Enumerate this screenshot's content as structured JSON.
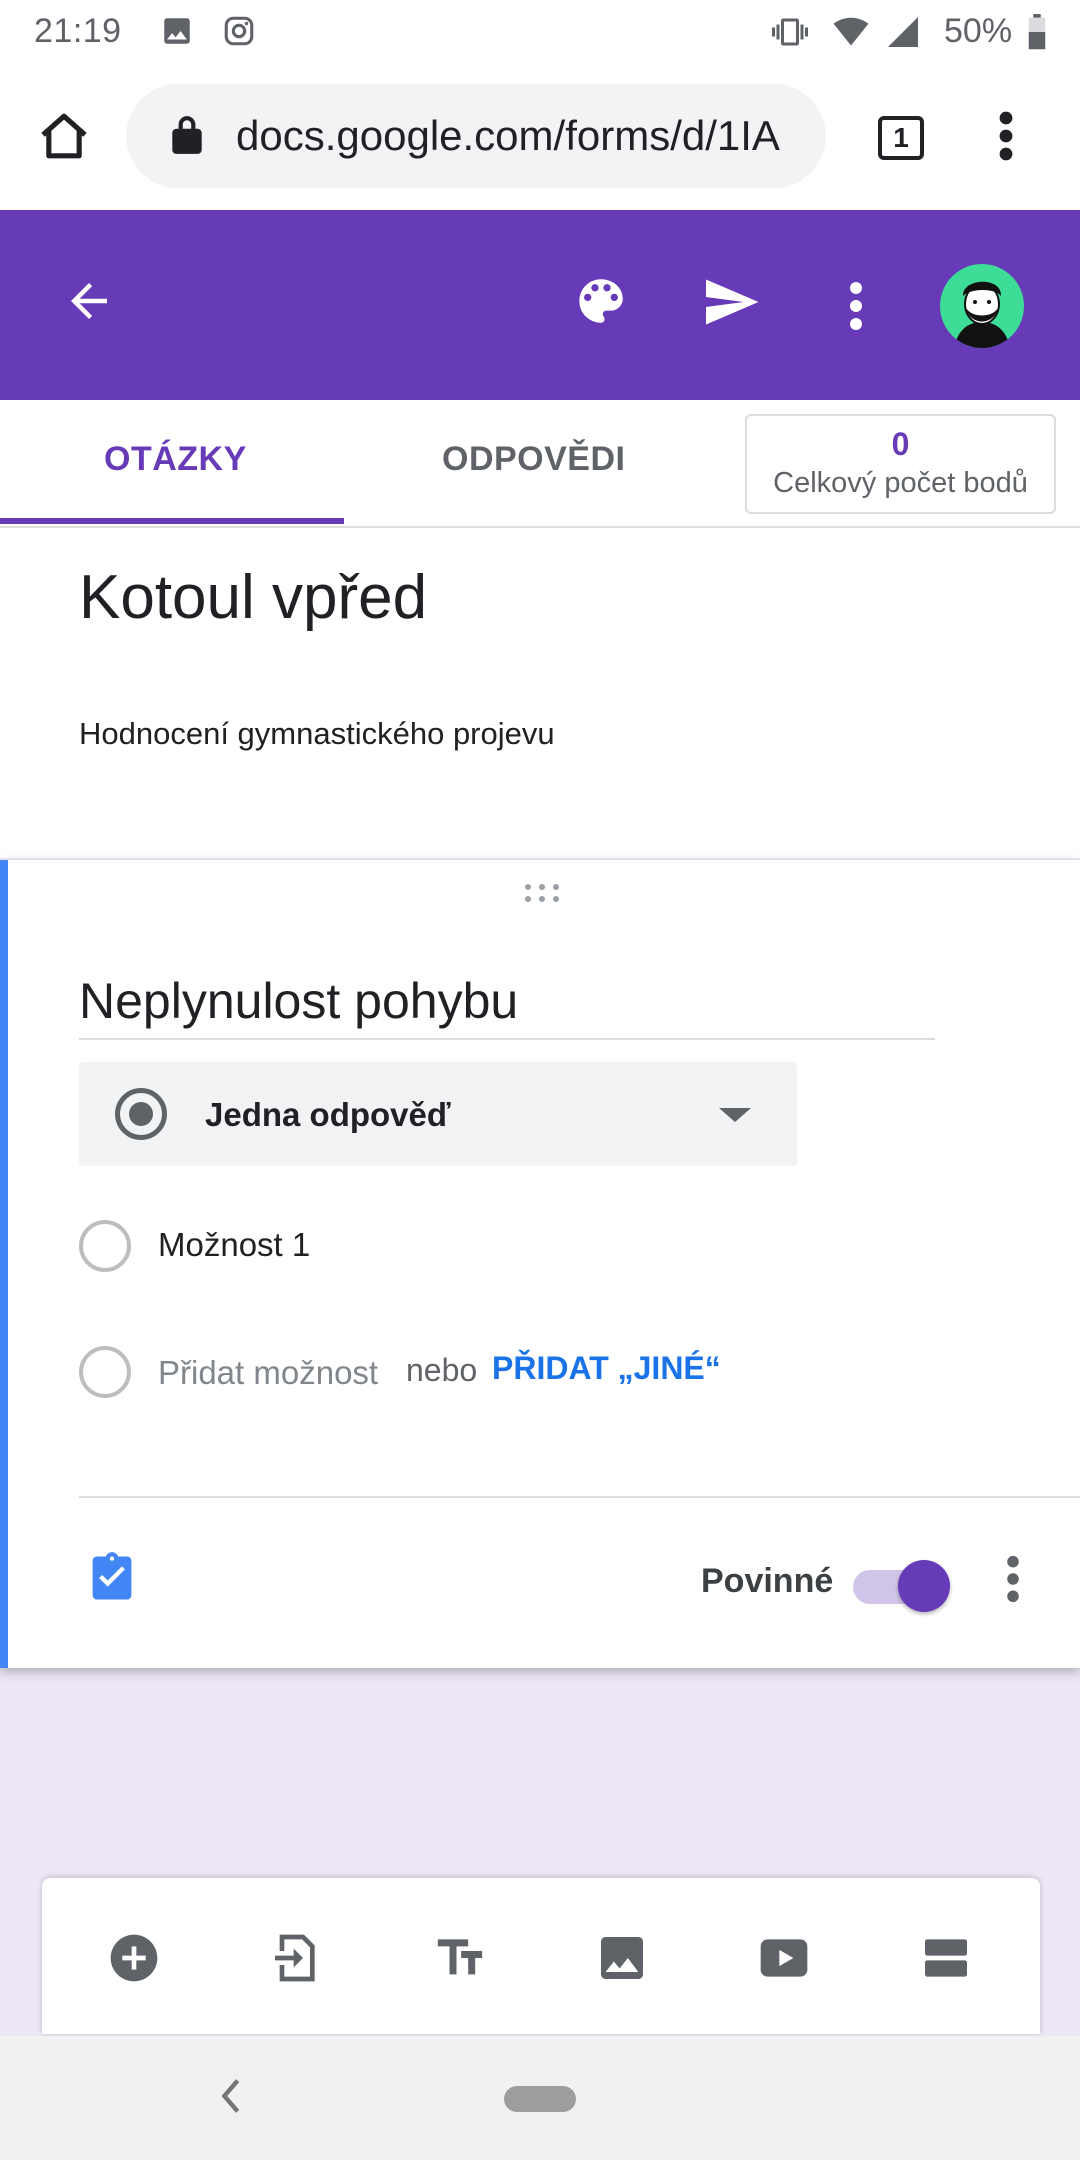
{
  "status_bar": {
    "time": "21:19",
    "battery_percent": "50%",
    "icons": [
      "image-icon",
      "instagram-icon",
      "vibrate-icon",
      "wifi-icon",
      "signal-icon",
      "battery-icon"
    ]
  },
  "browser": {
    "url": "docs.google.com/forms/d/1IA",
    "tab_count": "1",
    "icons": [
      "home-icon",
      "lock-icon",
      "tabs-icon",
      "more-vert-icon"
    ]
  },
  "app_bar": {
    "background_color": "#673ab7",
    "icons": [
      "back-arrow-icon",
      "palette-icon",
      "send-icon",
      "more-vert-icon",
      "avatar"
    ]
  },
  "tabs": {
    "questions": "OTÁZKY",
    "responses": "ODPOVĚDI",
    "active": "OTÁZKY",
    "total_points_value": "0",
    "total_points_label": "Celkový počet bodů"
  },
  "form": {
    "title": "Kotoul vpřed",
    "description": "Hodnocení gymnastického projevu"
  },
  "question": {
    "title": "Neplynulost pohybu",
    "type": "Jedna odpověď",
    "options": [
      "Možnost 1"
    ],
    "add_option": "Přidat možnost",
    "or_text": "nebo",
    "add_other": "PŘIDAT „JINÉ“",
    "required_label": "Povinné",
    "required": true,
    "accent_color": "#4285f4"
  },
  "toolbar": {
    "icons": [
      "add-question-icon",
      "import-questions-icon",
      "add-title-icon",
      "add-image-icon",
      "add-video-icon",
      "add-section-icon"
    ]
  }
}
